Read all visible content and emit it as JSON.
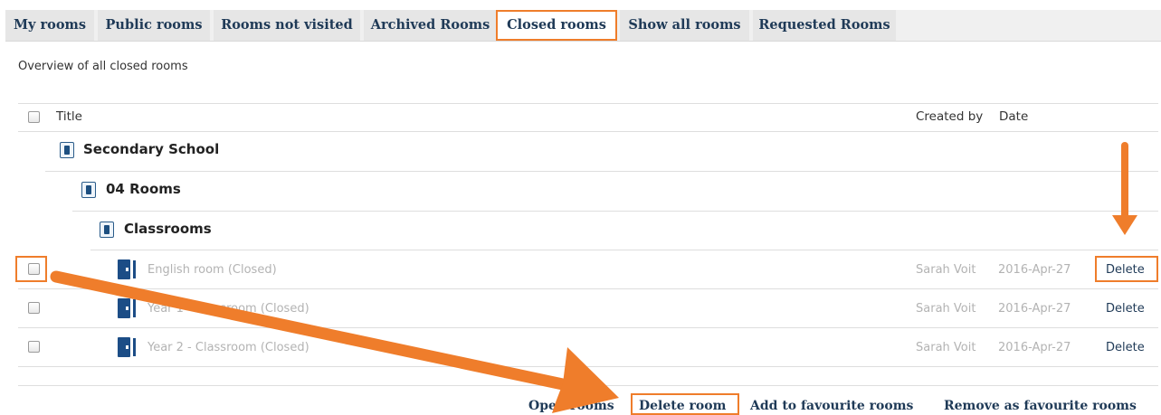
{
  "tabs": [
    {
      "label": "My rooms",
      "active": false
    },
    {
      "label": "Public rooms",
      "active": false
    },
    {
      "label": "Rooms not visited",
      "active": false
    },
    {
      "label": "Archived Rooms",
      "active": false
    },
    {
      "label": "Closed rooms",
      "active": true
    },
    {
      "label": "Show all rooms",
      "active": false
    },
    {
      "label": "Requested Rooms",
      "active": false
    }
  ],
  "subtitle": "Overview of all closed rooms",
  "table": {
    "headers": {
      "title": "Title",
      "created_by": "Created by",
      "date": "Date"
    },
    "groups": [
      {
        "label": "Secondary School",
        "icon": "folder-icon"
      },
      {
        "label": "04 Rooms",
        "icon": "folder-icon"
      },
      {
        "label": "Classrooms",
        "icon": "folder-icon"
      }
    ],
    "rows": [
      {
        "title": "English room (Closed)",
        "created_by": "Sarah Voit",
        "date": "2016-Apr-27",
        "action": "Delete"
      },
      {
        "title": "Year 1 - Classroom (Closed)",
        "created_by": "Sarah Voit",
        "date": "2016-Apr-27",
        "action": "Delete"
      },
      {
        "title": "Year 2 - Classroom (Closed)",
        "created_by": "Sarah Voit",
        "date": "2016-Apr-27",
        "action": "Delete"
      }
    ]
  },
  "actions": {
    "open": "Open rooms",
    "delete": "Delete room",
    "add_fav": "Add to favourite rooms",
    "remove_fav": "Remove as favourite rooms"
  },
  "colors": {
    "accent": "#ef7d2b",
    "link": "#1f3a57",
    "icon": "#1c4d86",
    "muted": "#b3b3b3"
  }
}
